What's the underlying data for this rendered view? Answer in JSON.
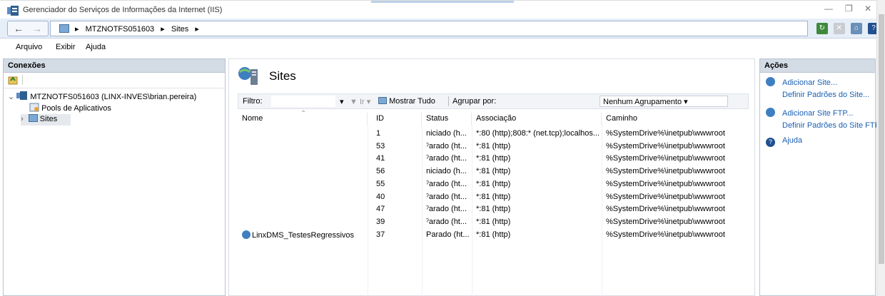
{
  "window": {
    "title": "Gerenciador do Serviços de Informações da Internet (IIS)",
    "minimize": "—",
    "restore": "❐",
    "close": "✕"
  },
  "address": {
    "crumbs": [
      "▸",
      "MTZNOTFS051603",
      "▸",
      "Sites",
      "▸"
    ],
    "back": "←",
    "forward": "→"
  },
  "menu": {
    "items": [
      "Arquivo",
      "Exibir",
      "Ajuda"
    ]
  },
  "connections": {
    "header": "Conexões",
    "server": "MTZNOTFS051603 (LINX-INVES\\brian.pereira)",
    "pools": "Pools de Aplicativos",
    "sites": "Sites"
  },
  "main": {
    "title": "Sites",
    "filter_label": "Filtro:",
    "filter_value": "",
    "go_label": "Ir",
    "show_all": "Mostrar Tudo",
    "group_label": "Agrupar por:",
    "group_value": "Nenhum Agrupamento",
    "columns": [
      "Nome",
      "ID",
      "Status",
      "Associação",
      "Caminho"
    ],
    "rows": [
      {
        "name": "",
        "id": "1",
        "status": "niciado (h...",
        "binding": "*:80 (http);808:* (net.tcp);localhos...",
        "path": "%SystemDrive%\\inetpub\\wwwroot"
      },
      {
        "name": "",
        "id": "53",
        "status": "ˀarado (ht...",
        "binding": "*:81 (http)",
        "path": "%SystemDrive%\\inetpub\\wwwroot"
      },
      {
        "name": "",
        "id": "41",
        "status": "ˀarado (ht...",
        "binding": "*:81 (http)",
        "path": "%SystemDrive%\\inetpub\\wwwroot"
      },
      {
        "name": "",
        "id": "56",
        "status": "niciado (h...",
        "binding": "*:81 (http)",
        "path": "%SystemDrive%\\inetpub\\wwwroot"
      },
      {
        "name": "",
        "id": "55",
        "status": "ˀarado (ht...",
        "binding": "*:81 (http)",
        "path": "%SystemDrive%\\inetpub\\wwwroot"
      },
      {
        "name": "",
        "id": "40",
        "status": "ˀarado (ht...",
        "binding": "*:81 (http)",
        "path": "%SystemDrive%\\inetpub\\wwwroot"
      },
      {
        "name": "",
        "id": "47",
        "status": "ˀarado (ht...",
        "binding": "*:81 (http)",
        "path": "%SystemDrive%\\inetpub\\wwwroot"
      },
      {
        "name": "",
        "id": "39",
        "status": "ˀarado (ht...",
        "binding": "*:81 (http)",
        "path": "%SystemDrive%\\inetpub\\wwwroot"
      },
      {
        "name": "LinxDMS_TestesRegressivos",
        "id": "37",
        "status": "Parado (ht...",
        "binding": "*:81 (http)",
        "path": "%SystemDrive%\\inetpub\\wwwroot"
      }
    ]
  },
  "actions": {
    "header": "Ações",
    "items": [
      {
        "label": "Adicionar Site...",
        "icon": "globe-add-icon"
      },
      {
        "label": "Definir Padrões do Site...",
        "icon": ""
      },
      {
        "label": "Adicionar Site FTP...",
        "icon": "globe-add-icon"
      },
      {
        "label": "Definir Padrões do Site FTP...",
        "icon": ""
      },
      {
        "label": "Ajuda",
        "icon": "help-icon"
      }
    ]
  },
  "colors": {
    "link": "#1a5fb4",
    "pane_header": "#d3dbe5",
    "address_bg": "#e6eef8"
  }
}
